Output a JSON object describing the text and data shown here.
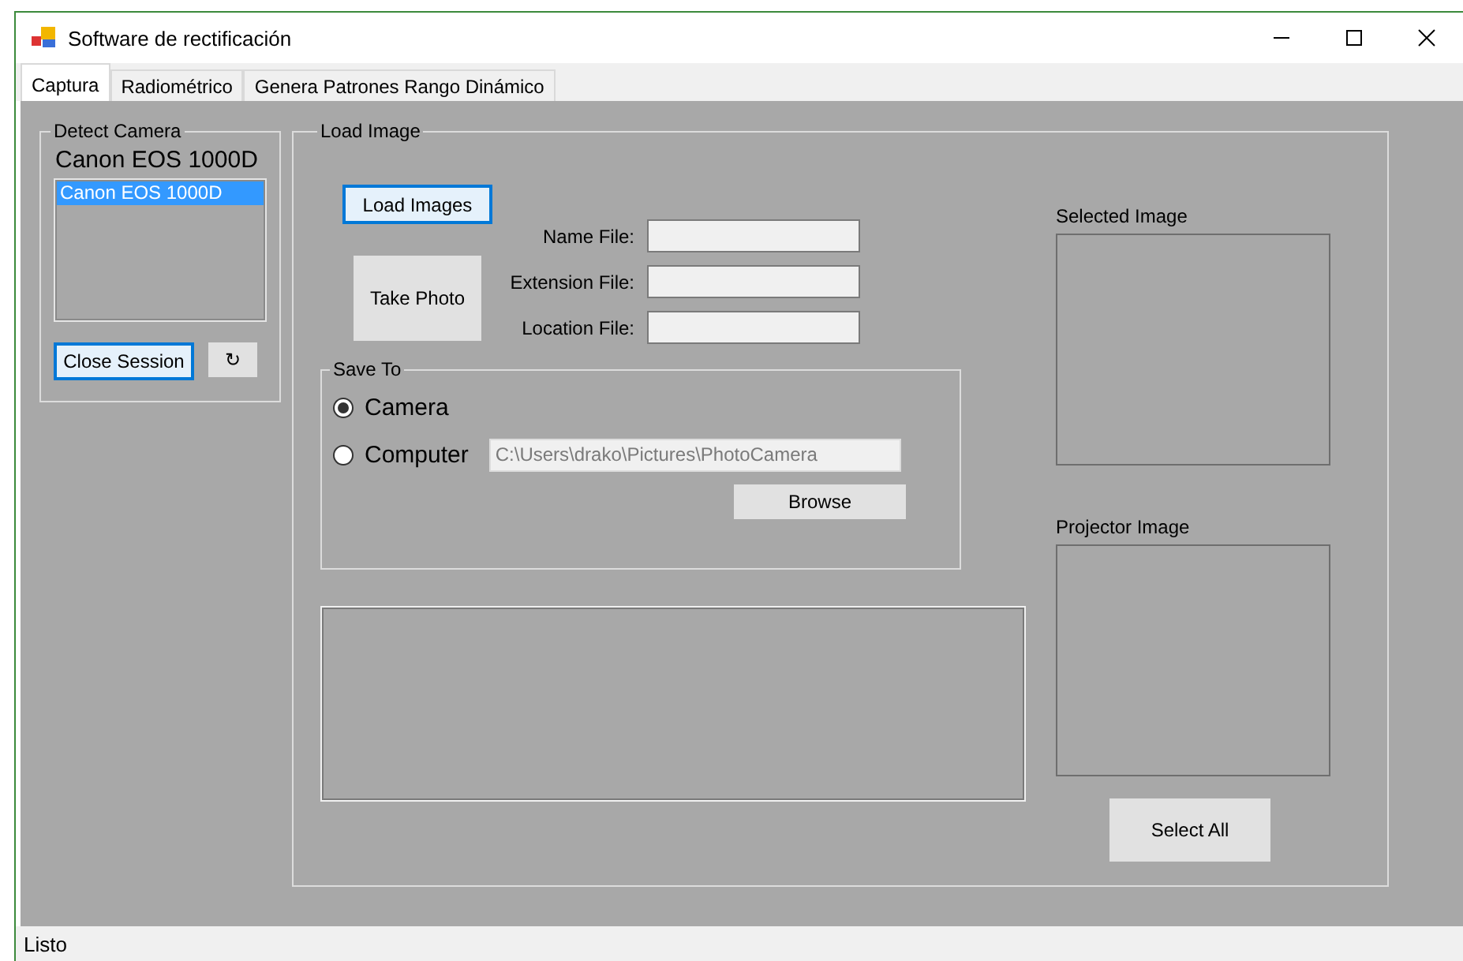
{
  "window": {
    "title": "Software de rectificación"
  },
  "tabs": [
    {
      "label": "Captura",
      "selected": true
    },
    {
      "label": "Radiométrico",
      "selected": false
    },
    {
      "label": "Genera Patrones Rango Dinámico",
      "selected": false
    }
  ],
  "detect_camera": {
    "title": "Detect Camera",
    "camera_name": "Canon EOS 1000D",
    "cameras": [
      {
        "label": "Canon EOS 1000D",
        "selected": true
      }
    ],
    "buttons": [
      {
        "label": "Close Session",
        "focused": true
      },
      {
        "label": "↻",
        "focused": false
      }
    ]
  },
  "load_image": {
    "title": "Load Image",
    "load_button": {
      "label": "Load Images",
      "focused": true
    },
    "take_photo_button": {
      "label": "Take Photo",
      "focused": false
    },
    "fields": [
      {
        "label": "Name File:"
      },
      {
        "label": "Extension File:"
      },
      {
        "label": "Location File:"
      }
    ],
    "save_to": {
      "title": "Save To",
      "options": [
        {
          "label": "Camera",
          "selected": true
        },
        {
          "label": "Computer",
          "selected": false
        }
      ],
      "path": {
        "value": "C:\\Users\\drako\\Pictures\\PhotoCamera",
        "disabled": true
      },
      "browse_button": {
        "label": "Browse",
        "focused": false
      }
    },
    "selected_image": {
      "label": "Selected Image"
    },
    "projector_image": {
      "label": "Projector Image"
    },
    "select_all_button": {
      "label": "Select All",
      "focused": false
    }
  },
  "status_bar": {
    "text": "Listo"
  }
}
